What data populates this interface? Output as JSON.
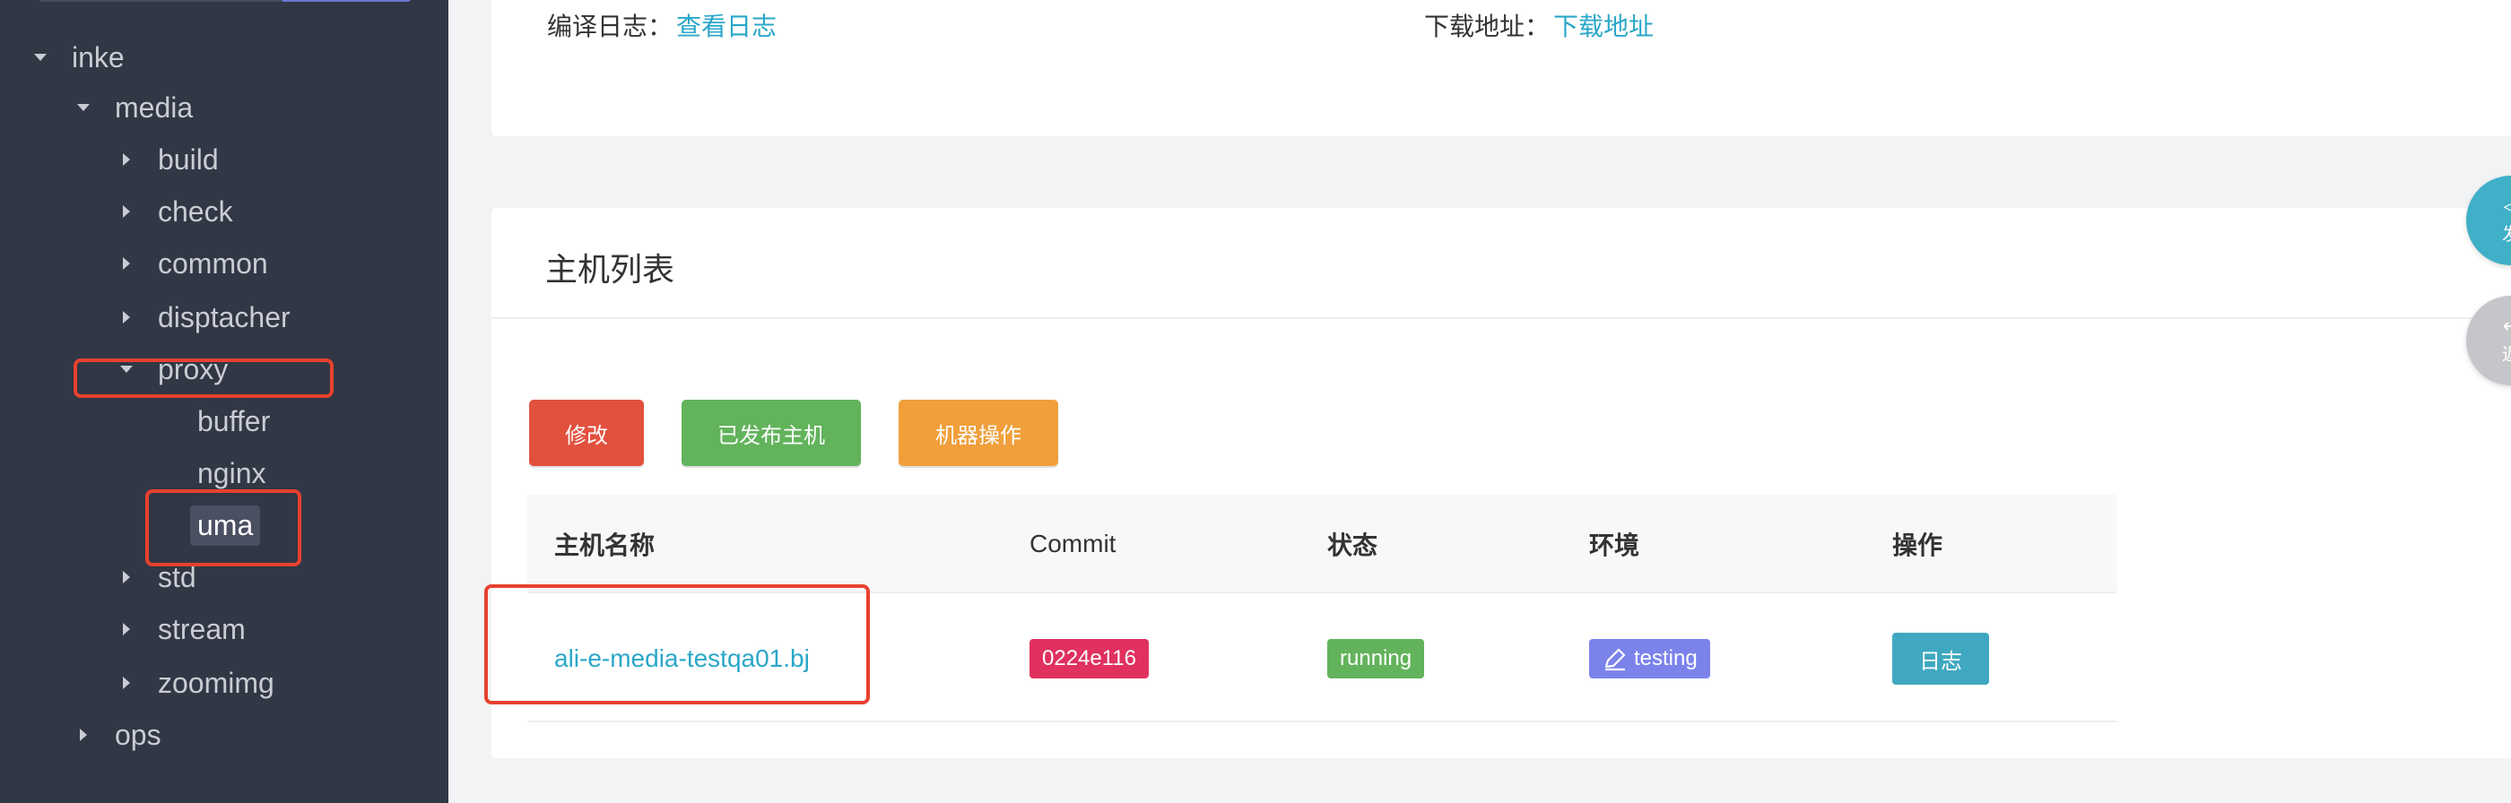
{
  "sidebar": {
    "tree": [
      {
        "label": "inke",
        "state": "expanded"
      },
      {
        "label": "media",
        "state": "expanded"
      },
      {
        "label": "build",
        "state": "collapsed"
      },
      {
        "label": "check",
        "state": "collapsed"
      },
      {
        "label": "common",
        "state": "collapsed"
      },
      {
        "label": "disptacher",
        "state": "collapsed"
      },
      {
        "label": "proxy",
        "state": "expanded"
      },
      {
        "label": "buffer",
        "state": "leaf"
      },
      {
        "label": "nginx",
        "state": "leaf"
      },
      {
        "label": "uma",
        "state": "leaf-selected"
      },
      {
        "label": "std",
        "state": "collapsed"
      },
      {
        "label": "stream",
        "state": "collapsed"
      },
      {
        "label": "zoomimg",
        "state": "collapsed"
      },
      {
        "label": "ops",
        "state": "collapsed"
      }
    ]
  },
  "top_card": {
    "build_log_label": "编译日志：",
    "build_log_link": "查看日志",
    "download_label": "下载地址：",
    "download_link": "下载地址"
  },
  "host_card": {
    "title": "主机列表",
    "buttons": {
      "edit": "修改",
      "published_hosts": "已发布主机",
      "machine_ops": "机器操作"
    },
    "columns": [
      "主机名称",
      "Commit",
      "状态",
      "环境",
      "操作"
    ],
    "rows": [
      {
        "host": "ali-e-media-testqa01.bj",
        "commit": "0224e116",
        "status": "running",
        "env": "testing",
        "action": "日志"
      }
    ]
  },
  "floating": {
    "publish_label": "发",
    "back_label": "返"
  },
  "colors": {
    "sidebar_bg": "#323745",
    "highlight_red": "#e8412f",
    "link": "#2aa7c9",
    "btn_edit": "#e2503e",
    "btn_published": "#62b35b",
    "btn_machine": "#f09f3b",
    "badge_commit": "#e0315f",
    "badge_running": "#62b35b",
    "badge_env": "#7b83eb",
    "btn_log": "#3fa8c0"
  }
}
